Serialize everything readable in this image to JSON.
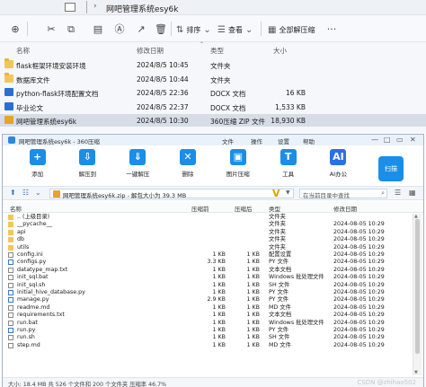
{
  "explorer": {
    "title": "网吧管理系统esy6k",
    "toolbar": {
      "sort_label": "排序",
      "view_label": "查看",
      "extract_all_label": "全部解压缩"
    },
    "columns": {
      "name": "名称",
      "date": "修改日期",
      "type": "类型",
      "size": "大小"
    },
    "files": [
      {
        "name": "flask框架环境安装环境",
        "date": "2024/8/5 10:45",
        "type": "文件夹",
        "size": "",
        "icon": "folder"
      },
      {
        "name": "数据库文件",
        "date": "2024/8/5 10:44",
        "type": "文件夹",
        "size": "",
        "icon": "folder"
      },
      {
        "name": "python-flask环境配置文档",
        "date": "2024/8/5 22:36",
        "type": "DOCX 文档",
        "size": "16 KB",
        "icon": "docx"
      },
      {
        "name": "毕业论文",
        "date": "2024/8/5 22:37",
        "type": "DOCX 文档",
        "size": "1,533 KB",
        "icon": "docx"
      },
      {
        "name": "网吧管理系统esy6k",
        "date": "2024/8/5 10:30",
        "type": "360压缩 ZIP 文件",
        "size": "18,930 KB",
        "icon": "zip",
        "selected": true
      }
    ]
  },
  "zip": {
    "title": "网吧管理系统esy6k - 360压缩",
    "menu": [
      "文件",
      "操作",
      "设置",
      "帮助"
    ],
    "ribbon": [
      {
        "label": "添加",
        "icon": "add-icon",
        "glyph": "+",
        "color": "#1a8ee8"
      },
      {
        "label": "解压到",
        "icon": "extract-icon",
        "glyph": "⇩",
        "color": "#1a8ee8"
      },
      {
        "label": "一键解压",
        "icon": "one-click-extract-icon",
        "glyph": "⇓",
        "color": "#1a8ee8"
      },
      {
        "label": "删除",
        "icon": "delete-icon",
        "glyph": "✕",
        "color": "#1a8ee8"
      },
      {
        "label": "图片压缩",
        "icon": "image-compress-icon",
        "glyph": "▣",
        "color": "#1a8ee8"
      },
      {
        "label": "工具",
        "icon": "tools-icon",
        "glyph": "T",
        "color": "#1a8ee8"
      },
      {
        "label": "AI办公",
        "icon": "ai-office-icon",
        "glyph": "AI",
        "color": "#2b6fe8"
      }
    ],
    "scan_label": "扫描",
    "address": "网吧管理系统esy6k.zip - 解包大小为 39.3 MB",
    "search_placeholder": "在当前目录中查找",
    "columns": {
      "name": "名称",
      "compressed": "压缩前",
      "packed": "压缩后",
      "type": "类型",
      "modified": "修改日期"
    },
    "entries": [
      {
        "name": ".. (上级目录)",
        "compressed": "",
        "packed": "",
        "type": "文件夹",
        "date": "",
        "icon": "up"
      },
      {
        "name": "__pycache__",
        "compressed": "",
        "packed": "",
        "type": "文件夹",
        "date": "2024-08-05 10:29",
        "icon": "folder"
      },
      {
        "name": "api",
        "compressed": "",
        "packed": "",
        "type": "文件夹",
        "date": "2024-08-05 10:29",
        "icon": "folder"
      },
      {
        "name": "db",
        "compressed": "",
        "packed": "",
        "type": "文件夹",
        "date": "2024-08-05 10:29",
        "icon": "folder"
      },
      {
        "name": "utils",
        "compressed": "",
        "packed": "",
        "type": "文件夹",
        "date": "2024-08-05 10:29",
        "icon": "folder"
      },
      {
        "name": "config.ini",
        "compressed": "1 KB",
        "packed": "1 KB",
        "type": "配置设置",
        "date": "2024-08-05 10:29",
        "icon": "file"
      },
      {
        "name": "configs.py",
        "compressed": "3.3 KB",
        "packed": "1 KB",
        "type": "PY 文件",
        "date": "2024-08-05 10:29",
        "icon": "py"
      },
      {
        "name": "datatype_map.txt",
        "compressed": "1 KB",
        "packed": "1 KB",
        "type": "文本文档",
        "date": "2024-08-05 10:29",
        "icon": "file"
      },
      {
        "name": "init_sql.bat",
        "compressed": "1 KB",
        "packed": "1 KB",
        "type": "Windows 批处理文件",
        "date": "2024-08-05 10:29",
        "icon": "file"
      },
      {
        "name": "init_sql.sh",
        "compressed": "1 KB",
        "packed": "1 KB",
        "type": "SH 文件",
        "date": "2024-08-05 10:29",
        "icon": "file"
      },
      {
        "name": "initial_hive_database.py",
        "compressed": "1 KB",
        "packed": "1 KB",
        "type": "PY 文件",
        "date": "2024-08-05 10:29",
        "icon": "py"
      },
      {
        "name": "manage.py",
        "compressed": "2.9 KB",
        "packed": "1 KB",
        "type": "PY 文件",
        "date": "2024-08-05 10:29",
        "icon": "py"
      },
      {
        "name": "readme.md",
        "compressed": "1 KB",
        "packed": "1 KB",
        "type": "MD 文件",
        "date": "2024-08-05 10:29",
        "icon": "file"
      },
      {
        "name": "requirements.txt",
        "compressed": "1 KB",
        "packed": "1 KB",
        "type": "文本文档",
        "date": "2024-08-05 10:29",
        "icon": "file"
      },
      {
        "name": "run.bat",
        "compressed": "1 KB",
        "packed": "1 KB",
        "type": "Windows 批处理文件",
        "date": "2024-08-05 10:29",
        "icon": "file"
      },
      {
        "name": "run.py",
        "compressed": "1 KB",
        "packed": "1 KB",
        "type": "PY 文件",
        "date": "2024-08-05 10:29",
        "icon": "py"
      },
      {
        "name": "run.sh",
        "compressed": "1 KB",
        "packed": "1 KB",
        "type": "SH 文件",
        "date": "2024-08-05 10:29",
        "icon": "file"
      },
      {
        "name": "step.md",
        "compressed": "1 KB",
        "packed": "1 KB",
        "type": "MD 文件",
        "date": "2024-08-05 10:29",
        "icon": "file"
      }
    ],
    "status": "大小: 18.4 MB 共 526 个文件和 200 个文件夹 压缩率 46.7%",
    "watermark": "CSDN @zhihao502"
  }
}
